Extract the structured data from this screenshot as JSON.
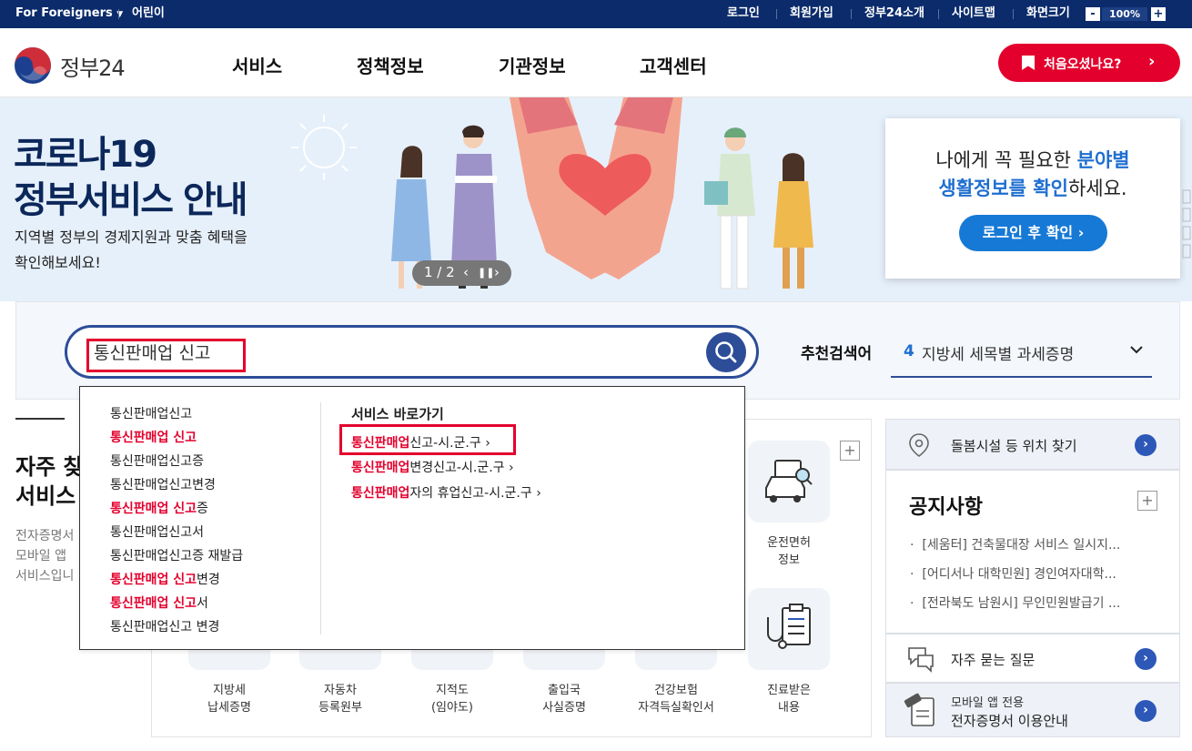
{
  "topbar": {
    "lang": "For Foreigners",
    "kids": "어린이",
    "links": [
      "로그인",
      "회원가입",
      "정부24소개",
      "사이트맵"
    ],
    "zoom_label": "화면크기",
    "zoom_minus": "-",
    "zoom_value": "100%",
    "zoom_plus": "+"
  },
  "header": {
    "logo_text": "정부24",
    "nav": [
      "서비스",
      "정책정보",
      "기관정보",
      "고객센터"
    ],
    "first_visit": "처음오셨나요?"
  },
  "banner": {
    "title_line1": "코로나19",
    "title_line2": "정부서비스 안내",
    "sub_line1": "지역별 정부의 경제지원과 맞춤 혜택을",
    "sub_line2": "확인해보세요!",
    "pager": "1 / 2",
    "card_line1_a": "나에게 꼭 필요한 ",
    "card_line1_b": "분야별",
    "card_line2_a": "생활정보를 확인",
    "card_line2_b": "하세요.",
    "card_button": "로그인 후 확인"
  },
  "search": {
    "value": "통신판매업 신고",
    "rec_label": "추천검색어",
    "rec_number": "4",
    "rec_text": "지방세 세목별 과세증명"
  },
  "dropdown": {
    "suggestions": [
      {
        "hl": "",
        "rest": "통신판매업신고"
      },
      {
        "hl": "통신판매업 신고",
        "rest": ""
      },
      {
        "hl": "",
        "rest": "통신판매업신고증"
      },
      {
        "hl": "",
        "rest": "통신판매업신고변경"
      },
      {
        "hl": "통신판매업 신고",
        "rest": "증"
      },
      {
        "hl": "",
        "rest": "통신판매업신고서"
      },
      {
        "hl": "",
        "rest": "통신판매업신고증 재발급"
      },
      {
        "hl": "통신판매업 신고",
        "rest": "변경"
      },
      {
        "hl": "통신판매업 신고",
        "rest": "서"
      },
      {
        "hl": "",
        "rest": "통신판매업신고 변경"
      }
    ],
    "quick_title": "서비스 바로가기",
    "quick_links": [
      {
        "hl": "통신판매업",
        "rest": "신고-시.군.구"
      },
      {
        "hl": "통신판매업",
        "rest": "변경신고-시.군.구"
      },
      {
        "hl": "통신판매업",
        "rest": "자의 휴업신고-시.군.구"
      }
    ]
  },
  "services": {
    "title_line1": "자주 찾",
    "title_line2": "서비스",
    "desc": [
      "전자증명서",
      "모바일 앱",
      "서비스입니"
    ],
    "tiles_row1": [
      {
        "l1": "운전면허",
        "l2": "정보"
      }
    ],
    "tiles_row2": [
      {
        "l1": "지방세",
        "l2": "납세증명"
      },
      {
        "l1": "자동차",
        "l2": "등록원부"
      },
      {
        "l1": "지적도",
        "l2": "(임야도)"
      },
      {
        "l1": "출입국",
        "l2": "사실증명"
      },
      {
        "l1": "건강보험",
        "l2": "자격득실확인서"
      },
      {
        "l1": "진료받은",
        "l2": "내용"
      }
    ]
  },
  "right": {
    "care_finder": "돌봄시설 등 위치 찾기",
    "notice_title": "공지사항",
    "notices": [
      "[세움터] 건축물대장 서비스 일시지...",
      "[어디서나 대학민원] 경인여자대학...",
      "[전라북도 남원시] 무인민원발급기 ..."
    ],
    "faq": "자주 묻는 질문",
    "mobile_line1": "모바일 앱 전용",
    "mobile_line2": "전자증명서 이용안내"
  }
}
